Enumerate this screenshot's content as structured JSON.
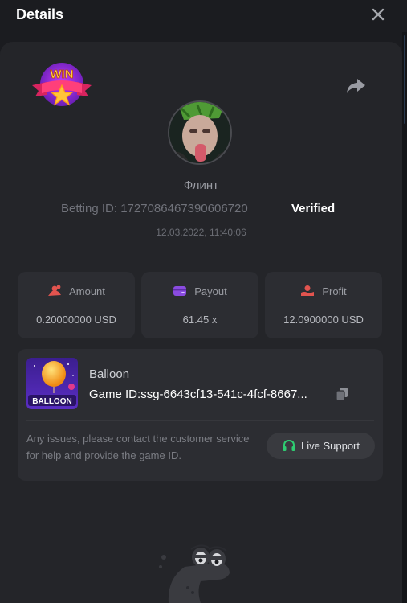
{
  "header": {
    "title": "Details"
  },
  "bet": {
    "username": "Флинт",
    "betting_id_label": "Betting ID: ",
    "betting_id": "1727086467390606720",
    "verified": "Verified",
    "datetime": "12.03.2022, 11:40:06",
    "badge_text": "WIN"
  },
  "stats": {
    "amount": {
      "label": "Amount",
      "value": "0.20000000 USD"
    },
    "payout": {
      "label": "Payout",
      "value": "61.45 x"
    },
    "profit": {
      "label": "Profit",
      "value": "12.0900000 USD"
    }
  },
  "game": {
    "name": "Balloon",
    "thumb_text": "BALLOON",
    "id_label": "Game ID:",
    "id_value": "ssg-6643cf13-541c-4fcf-8667...",
    "issue_text": "Any issues, please contact the customer service for help and provide the game ID.",
    "support_label": "Live Support"
  },
  "colors": {
    "background": "#1b1c20",
    "panel": "#242529",
    "card": "#2c2d32",
    "amount_icon": "#e2544f",
    "payout_icon": "#8a4be0",
    "profit_icon": "#e2544f",
    "support_icon": "#2ecc71"
  },
  "icons": {
    "close": "close-icon",
    "share": "share-icon",
    "amount": "coins-icon",
    "payout": "wallet-icon",
    "profit": "hand-coin-icon",
    "copy": "copy-icon",
    "support": "headset-icon"
  }
}
